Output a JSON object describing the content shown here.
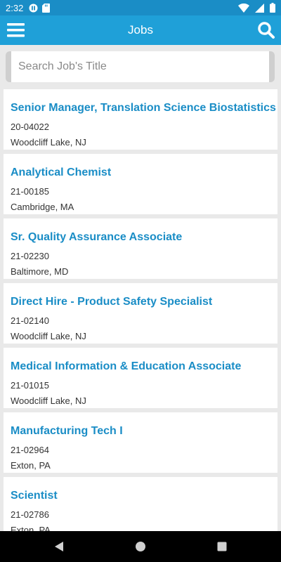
{
  "status_bar": {
    "time": "2:32",
    "icons": [
      "pause-icon",
      "sd-card-icon",
      "wifi-icon",
      "signal-icon",
      "battery-icon"
    ]
  },
  "app_bar": {
    "title": "Jobs",
    "menu_icon": "hamburger-menu-icon",
    "search_icon": "search-icon"
  },
  "search": {
    "placeholder": "Search Job's Title"
  },
  "jobs": [
    {
      "title": "Senior Manager, Translation Science Biostatistics",
      "code": "20-04022",
      "location": "Woodcliff Lake, NJ"
    },
    {
      "title": "Analytical Chemist",
      "code": "21-00185",
      "location": "Cambridge, MA"
    },
    {
      "title": "Sr. Quality Assurance Associate",
      "code": "21-02230",
      "location": "Baltimore, MD"
    },
    {
      "title": "Direct Hire - Product Safety Specialist",
      "code": "21-02140",
      "location": "Woodcliff Lake, NJ"
    },
    {
      "title": "Medical Information & Education Associate",
      "code": "21-01015",
      "location": "Woodcliff Lake, NJ"
    },
    {
      "title": "Manufacturing Tech I",
      "code": "21-02964",
      "location": "Exton, PA"
    },
    {
      "title": "Scientist",
      "code": "21-02786",
      "location": "Exton, PA"
    }
  ],
  "colors": {
    "app_bar": "#1fa0d8",
    "status_bar": "#1a8dc6",
    "title_link": "#1a8dc6",
    "background": "#e9e9e9"
  }
}
